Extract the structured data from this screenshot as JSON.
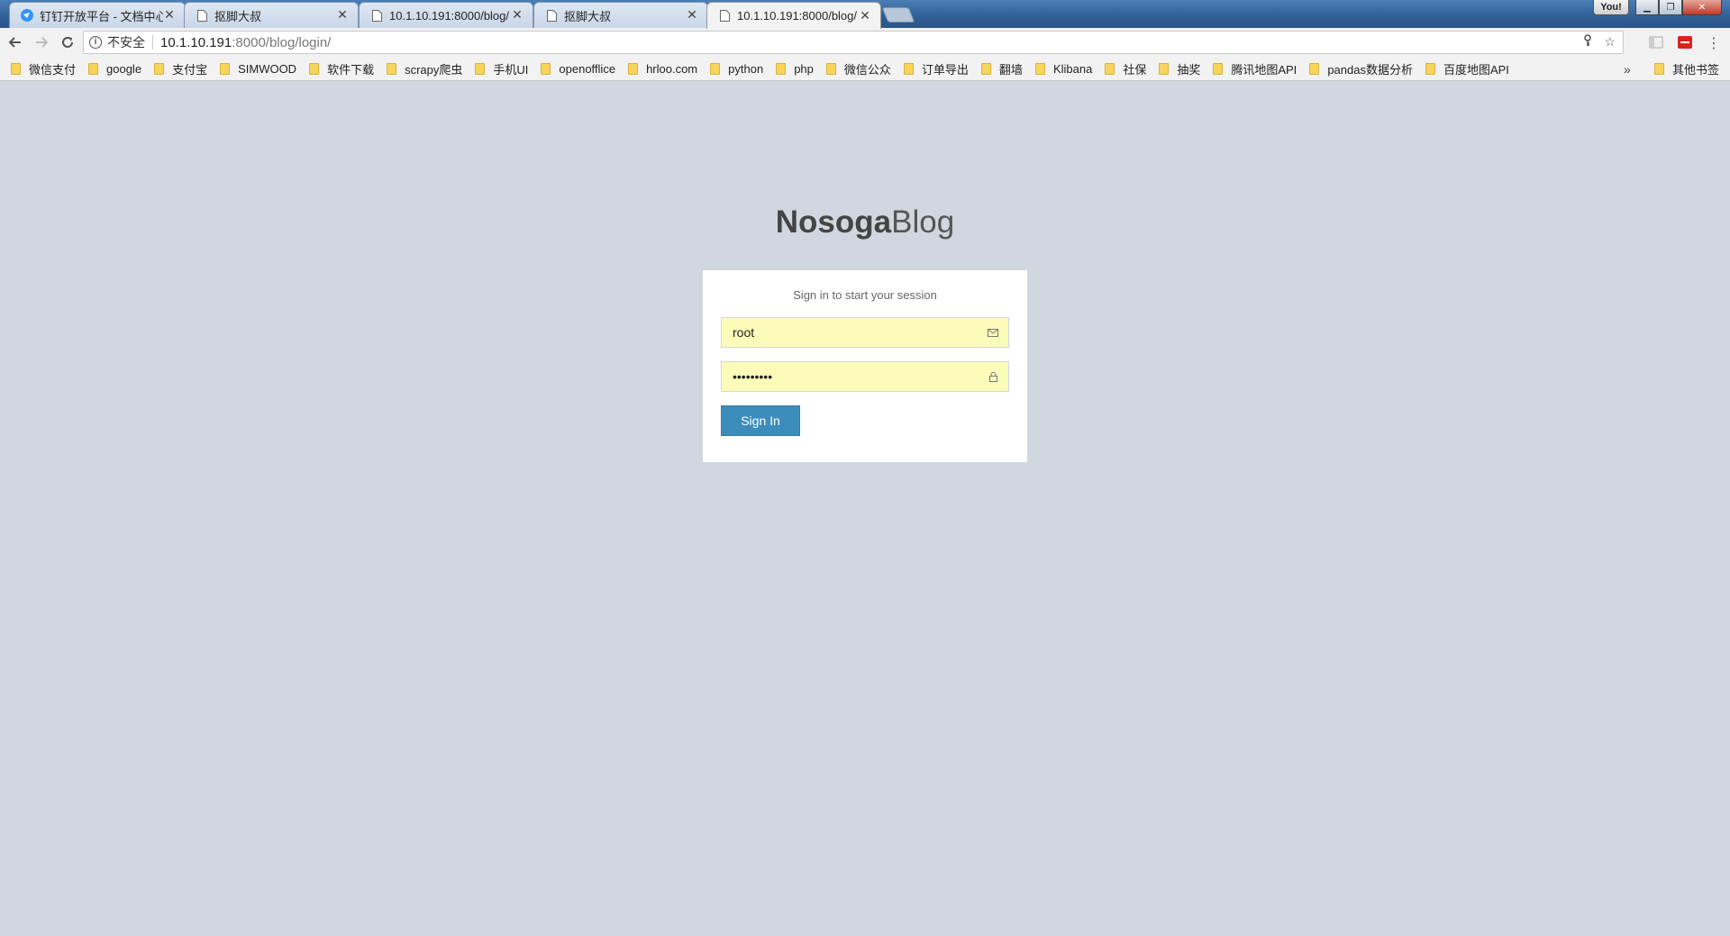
{
  "browser": {
    "tabs": [
      {
        "title": "钉钉开放平台 - 文档中心",
        "icon": "dingtalk-icon",
        "active": false
      },
      {
        "title": "抠脚大叔",
        "icon": "page-icon",
        "active": false
      },
      {
        "title": "10.1.10.191:8000/blog/",
        "icon": "page-icon",
        "active": false
      },
      {
        "title": "抠脚大叔",
        "icon": "page-icon",
        "active": false
      },
      {
        "title": "10.1.10.191:8000/blog/",
        "icon": "page-icon",
        "active": true
      }
    ],
    "user_label": "You!",
    "address": {
      "security_label": "不安全",
      "host": "10.1.10.191",
      "path": ":8000/blog/login/"
    },
    "bookmarks": [
      "微信支付",
      "google",
      "支付宝",
      "SIMWOOD",
      "软件下载",
      "scrapy爬虫",
      "手机UI",
      "openofflice",
      "hrloo.com",
      "python",
      "php",
      "微信公众",
      "订单导出",
      "翻墙",
      "Klibana",
      "社保",
      "抽奖",
      "腾讯地图API",
      "pandas数据分析",
      "百度地图API"
    ],
    "bookmarks_overflow": "»",
    "other_bookmarks": "其他书签"
  },
  "page": {
    "logo_bold": "Nosoga",
    "logo_light": "Blog",
    "login_message": "Sign in to start your session",
    "username_value": "root",
    "password_value": "•••••••••",
    "signin_label": "Sign In"
  },
  "colors": {
    "page_bg": "#d2d6de",
    "input_autofill_bg": "#fbfcb9",
    "button_primary": "#3c8dbc"
  }
}
